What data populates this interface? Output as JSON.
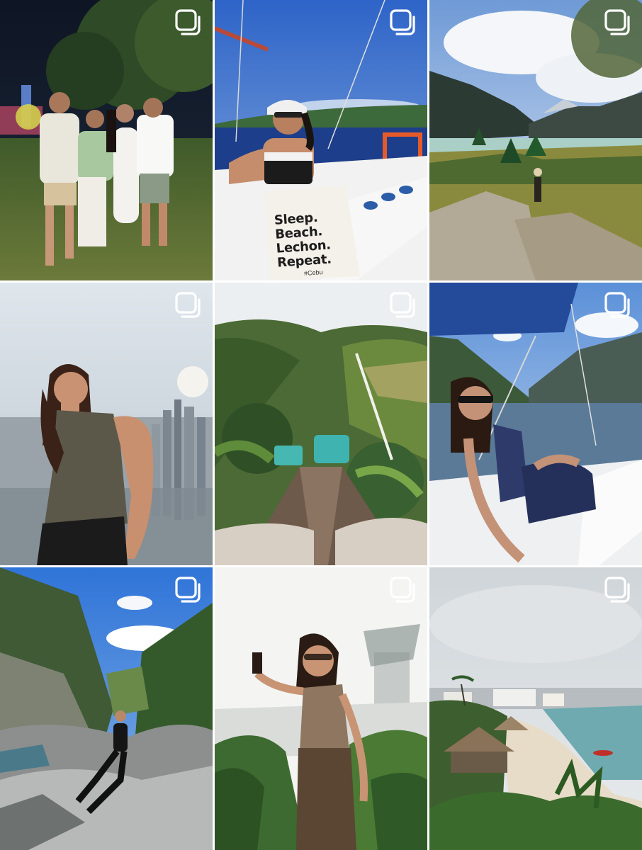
{
  "grid": {
    "posts": [
      {
        "type": "carousel",
        "icon": "carousel-multiple-icon"
      },
      {
        "type": "carousel",
        "icon": "carousel-multiple-icon",
        "tote_text": "Sleep.\nBeach.\nLechon.\nRepeat.",
        "tote_tag": "#Cebu"
      },
      {
        "type": "carousel",
        "icon": "carousel-multiple-icon"
      },
      {
        "type": "carousel",
        "icon": "carousel-multiple-icon"
      },
      {
        "type": "carousel",
        "icon": "carousel-multiple-icon"
      },
      {
        "type": "carousel",
        "icon": "carousel-multiple-icon"
      },
      {
        "type": "carousel",
        "icon": "carousel-multiple-icon"
      },
      {
        "type": "carousel",
        "icon": "carousel-multiple-icon"
      },
      {
        "type": "carousel",
        "icon": "carousel-multiple-icon"
      }
    ]
  },
  "colors": {
    "background": "#ffffff",
    "icon": "#ffffff"
  }
}
